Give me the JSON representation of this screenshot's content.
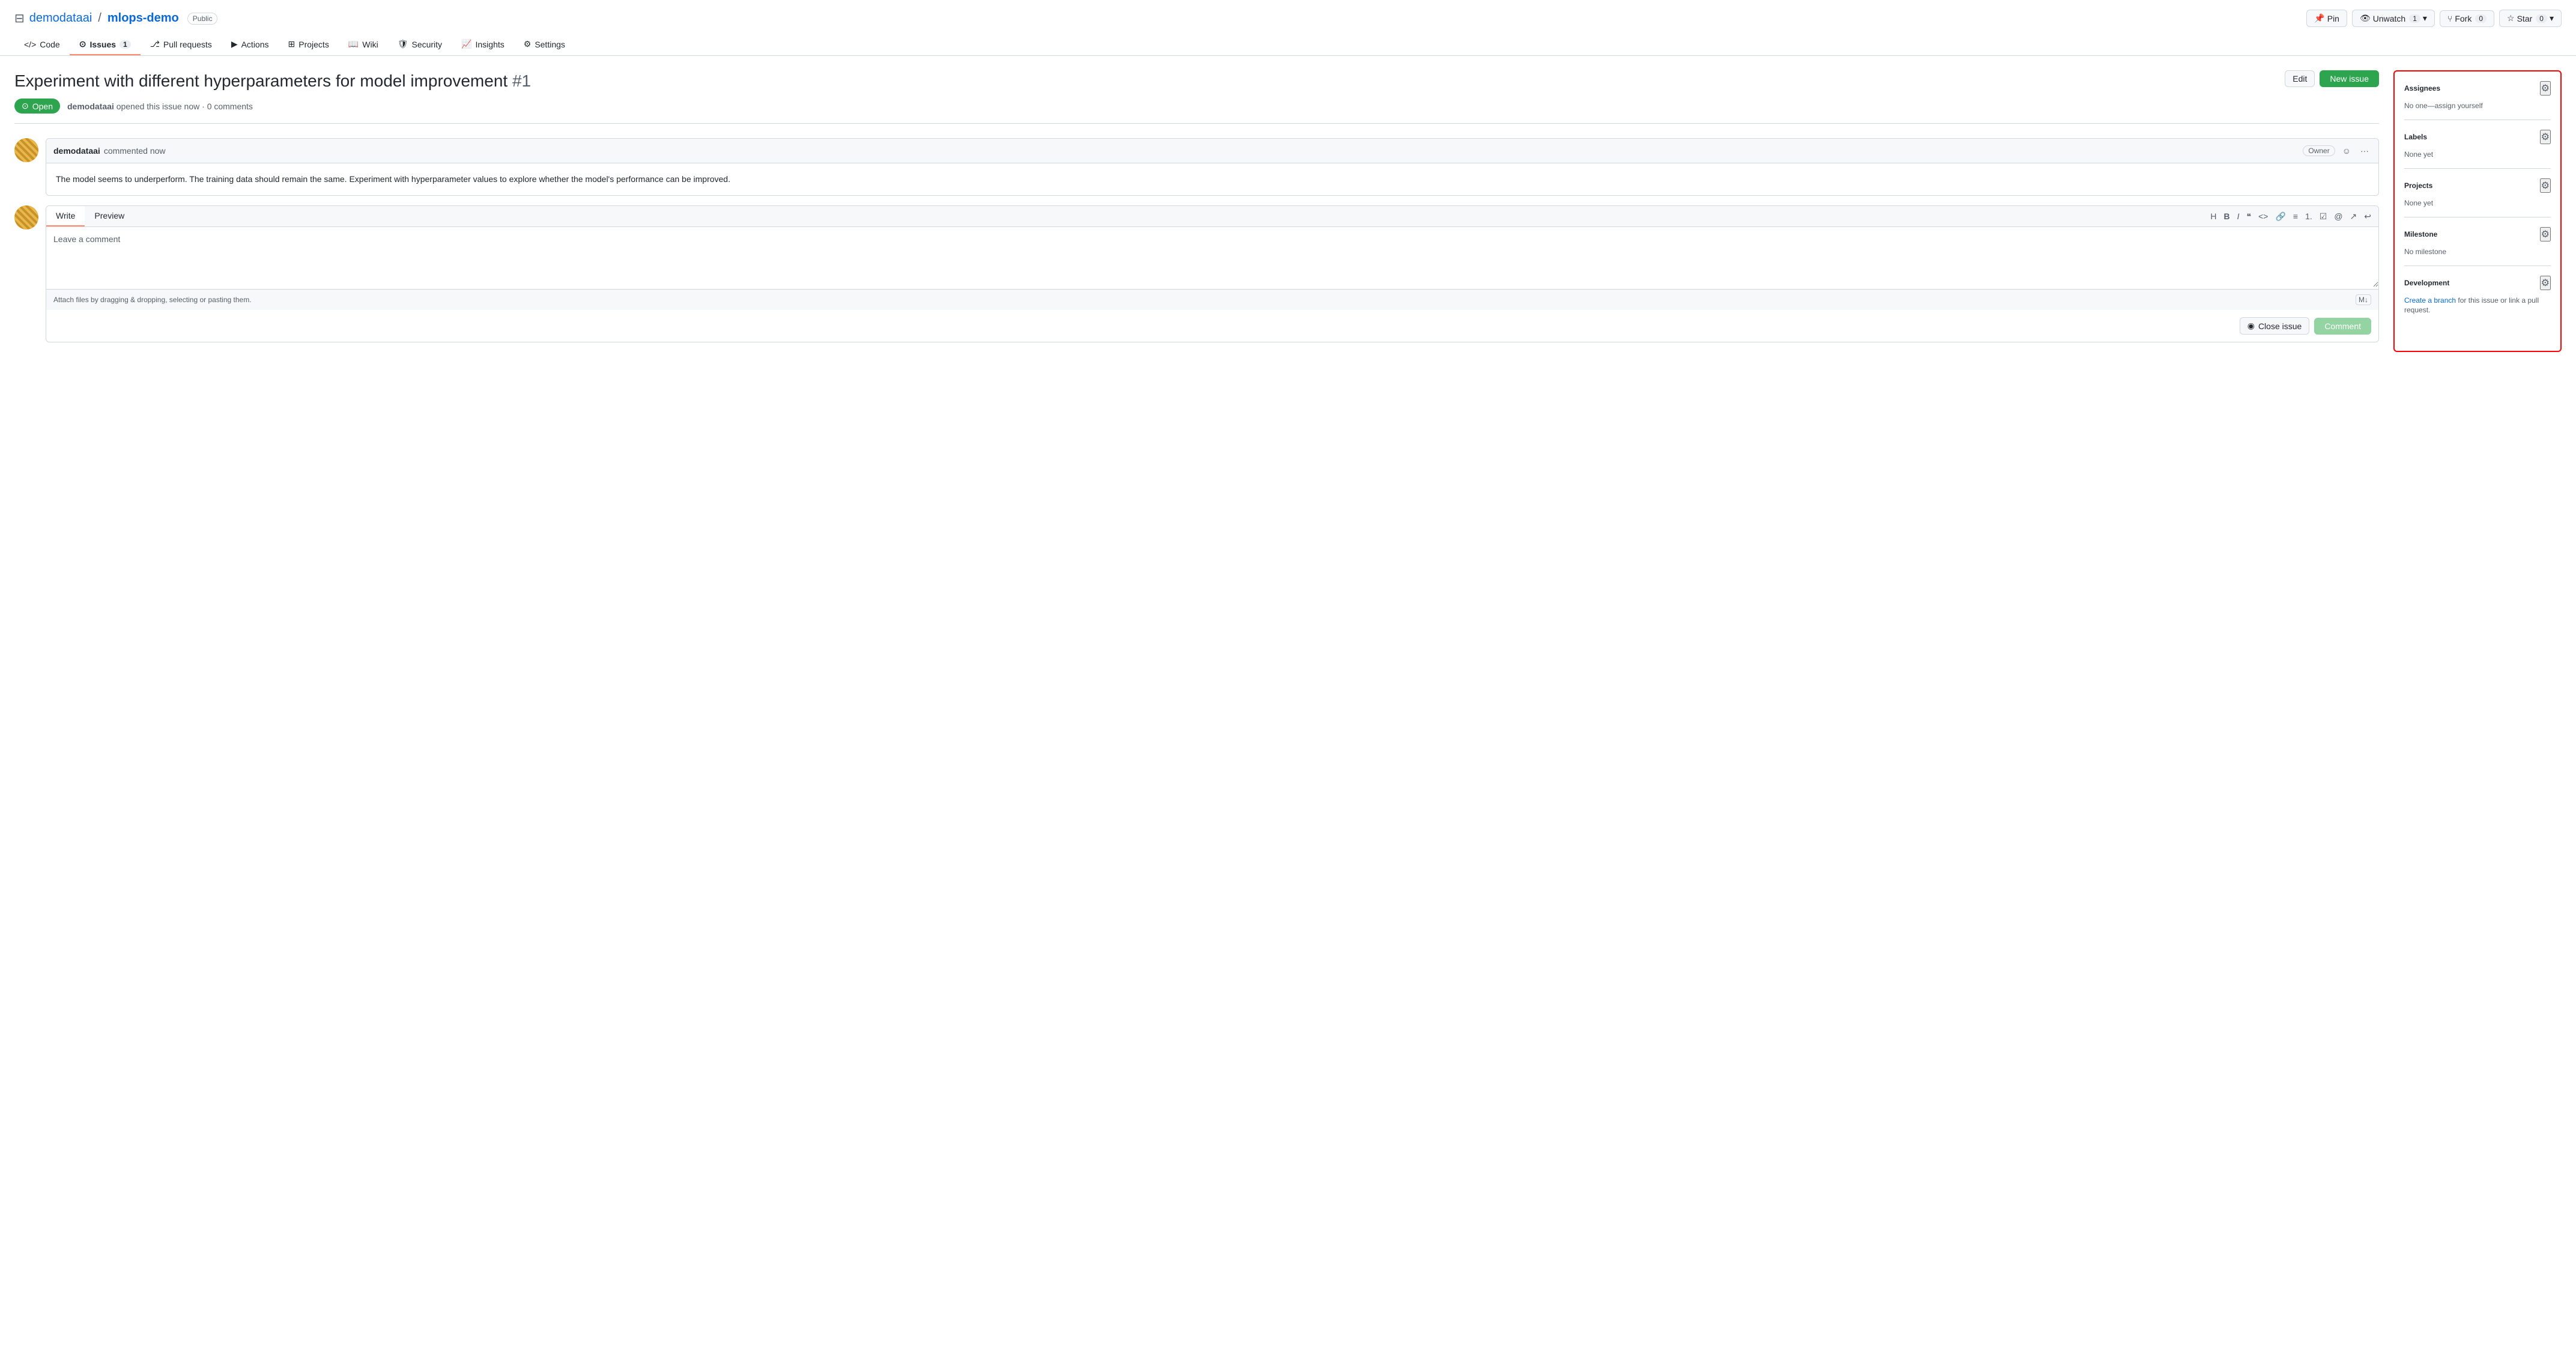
{
  "repo": {
    "owner": "demodataai",
    "name": "mlops-demo",
    "visibility": "Public",
    "icon": "⊟"
  },
  "header_actions": {
    "pin": "Pin",
    "unwatch": "Unwatch",
    "unwatch_count": "1",
    "fork": "Fork",
    "fork_count": "0",
    "star": "Star",
    "star_count": "0"
  },
  "nav": {
    "items": [
      {
        "label": "Code",
        "icon": "</>",
        "active": false,
        "badge": null
      },
      {
        "label": "Issues",
        "icon": "⊙",
        "active": true,
        "badge": "1"
      },
      {
        "label": "Pull requests",
        "icon": "⎇",
        "active": false,
        "badge": null
      },
      {
        "label": "Actions",
        "icon": "▶",
        "active": false,
        "badge": null
      },
      {
        "label": "Projects",
        "icon": "⊞",
        "active": false,
        "badge": null
      },
      {
        "label": "Wiki",
        "icon": "📖",
        "active": false,
        "badge": null
      },
      {
        "label": "Security",
        "icon": "🛡",
        "active": false,
        "badge": null
      },
      {
        "label": "Insights",
        "icon": "📈",
        "active": false,
        "badge": null
      },
      {
        "label": "Settings",
        "icon": "⚙",
        "active": false,
        "badge": null
      }
    ]
  },
  "issue": {
    "title": "Experiment with different hyperparameters for model improvement",
    "number": "#1",
    "status": "Open",
    "author": "demodataai",
    "time": "opened this issue now",
    "comments_count": "0 comments",
    "edit_label": "Edit",
    "new_issue_label": "New issue"
  },
  "comment": {
    "author": "demodataai",
    "time": "commented now",
    "owner_badge": "Owner",
    "body": "The model seems to underperform. The training data should remain the same. Experiment with hyperparameter values to explore whether the model's performance can be improved."
  },
  "reply": {
    "write_tab": "Write",
    "preview_tab": "Preview",
    "placeholder": "Leave a comment",
    "attach_text": "Attach files by dragging & dropping, selecting or pasting them.",
    "close_issue_label": "Close issue",
    "comment_label": "Comment",
    "toolbar": {
      "h": "H",
      "b": "B",
      "i": "I",
      "quote": "\"",
      "code": "<>",
      "link": "🔗",
      "ul": "≡",
      "ol": "1.",
      "task": "☑",
      "mention": "@",
      "ref": "↗",
      "undo": "↩"
    }
  },
  "sidebar": {
    "assignees": {
      "title": "Assignees",
      "value": "No one—assign yourself"
    },
    "labels": {
      "title": "Labels",
      "value": "None yet"
    },
    "projects": {
      "title": "Projects",
      "value": "None yet"
    },
    "milestone": {
      "title": "Milestone",
      "value": "No milestone"
    },
    "development": {
      "title": "Development",
      "link_text": "Create a branch",
      "suffix": " for this issue or link a pull request."
    }
  }
}
